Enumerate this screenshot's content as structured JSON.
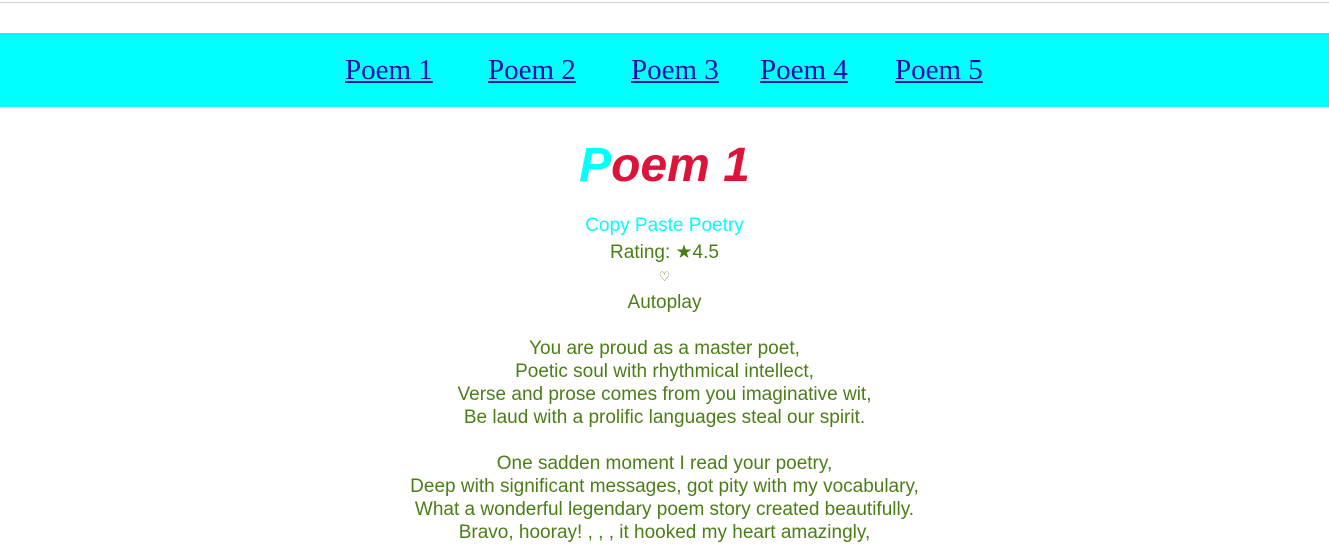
{
  "nav": {
    "links": [
      "Poem 1",
      "Poem 2",
      "Poem 3",
      "Poem 4",
      "Poem 5"
    ]
  },
  "poem": {
    "title_first": "P",
    "title_rest": "oem 1",
    "subtitle": "Copy Paste Poetry",
    "rating": "Rating: ★4.5",
    "heart": "♡",
    "autoplay": "Autoplay",
    "stanza1": [
      "You are proud as a master poet,",
      "Poetic soul with rhythmical intellect,",
      "Verse and prose comes from you imaginative wit,",
      "Be laud with a prolific languages steal our spirit."
    ],
    "stanza2": [
      "One sadden moment I read your poetry,",
      "Deep with significant messages, got pity with my vocabulary,",
      "What a wonderful legendary poem story created beautifully.",
      "Bravo, hooray! , , , it hooked my heart amazingly,"
    ]
  },
  "colors": {
    "nav_background": "#00ffff",
    "title_first_letter": "#00ffff",
    "title": "#dc143c",
    "body_text": "#4b7e16",
    "link": "#1a0dab"
  }
}
